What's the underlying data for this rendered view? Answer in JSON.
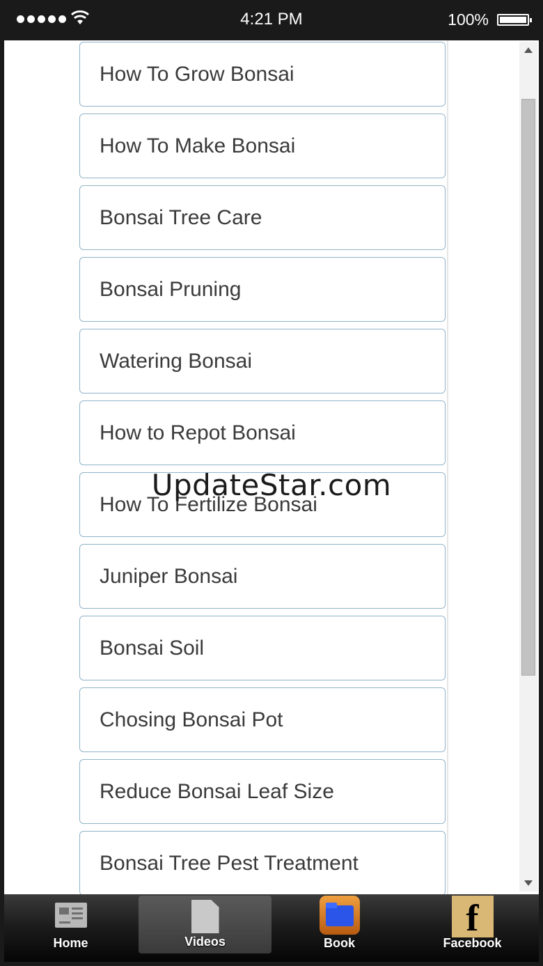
{
  "status_bar": {
    "time": "4:21 PM",
    "battery": "100%"
  },
  "menu": {
    "items": [
      {
        "label": "How To Grow Bonsai"
      },
      {
        "label": "How To Make Bonsai"
      },
      {
        "label": "Bonsai Tree Care"
      },
      {
        "label": "Bonsai Pruning"
      },
      {
        "label": "Watering Bonsai"
      },
      {
        "label": "How to Repot Bonsai"
      },
      {
        "label": "How To Fertilize Bonsai"
      },
      {
        "label": "Juniper Bonsai"
      },
      {
        "label": "Bonsai Soil"
      },
      {
        "label": "Chosing Bonsai Pot"
      },
      {
        "label": "Reduce Bonsai Leaf Size"
      },
      {
        "label": "Bonsai Tree Pest Treatment"
      }
    ]
  },
  "watermark": "UpdateStar.com",
  "tabbar": {
    "tabs": [
      {
        "label": "Home",
        "icon": "newspaper-icon"
      },
      {
        "label": "Videos",
        "icon": "document-icon",
        "active": true
      },
      {
        "label": "Book",
        "icon": "folder-icon"
      },
      {
        "label": "Facebook",
        "icon": "facebook-icon",
        "icon_text": "f"
      }
    ]
  },
  "colors": {
    "item_border": "#8fb3c9",
    "item_text": "#3a3a3a",
    "tabbar_bg": "#1d1d1d",
    "facebook_icon_bg": "#d9b774",
    "book_icon_bg": "#e08a30"
  }
}
